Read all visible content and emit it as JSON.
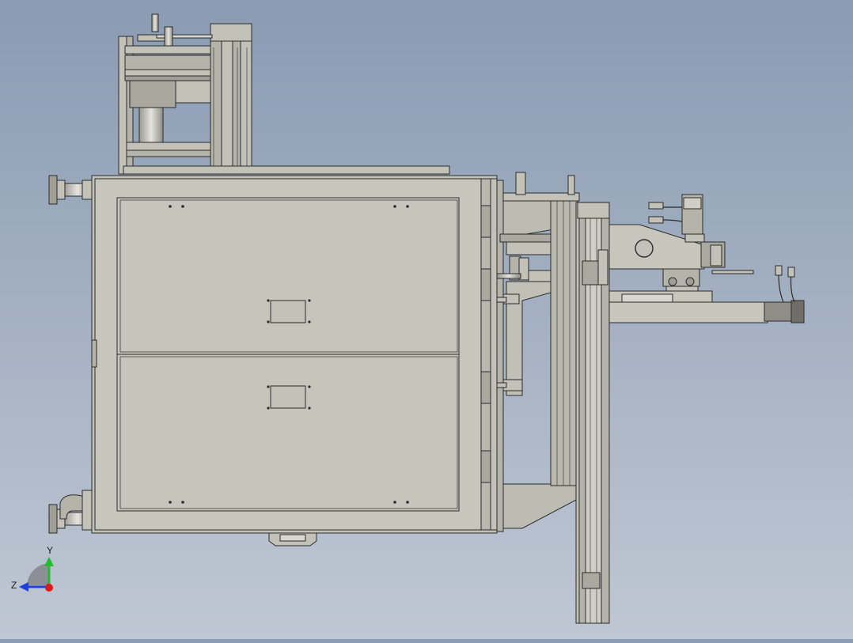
{
  "viewport": {
    "background_top": "#8a9bb2",
    "background_bottom": "#bfc7d3",
    "part_fill": "#c2c2b8",
    "part_fill_dark": "#a9a99f",
    "edge_color": "#2b2b2b"
  },
  "triad": {
    "y_label": "Y",
    "z_label": "Z",
    "y_color": "#1fbf2a",
    "z_color": "#1f3fdf",
    "x_color": "#e01818"
  }
}
